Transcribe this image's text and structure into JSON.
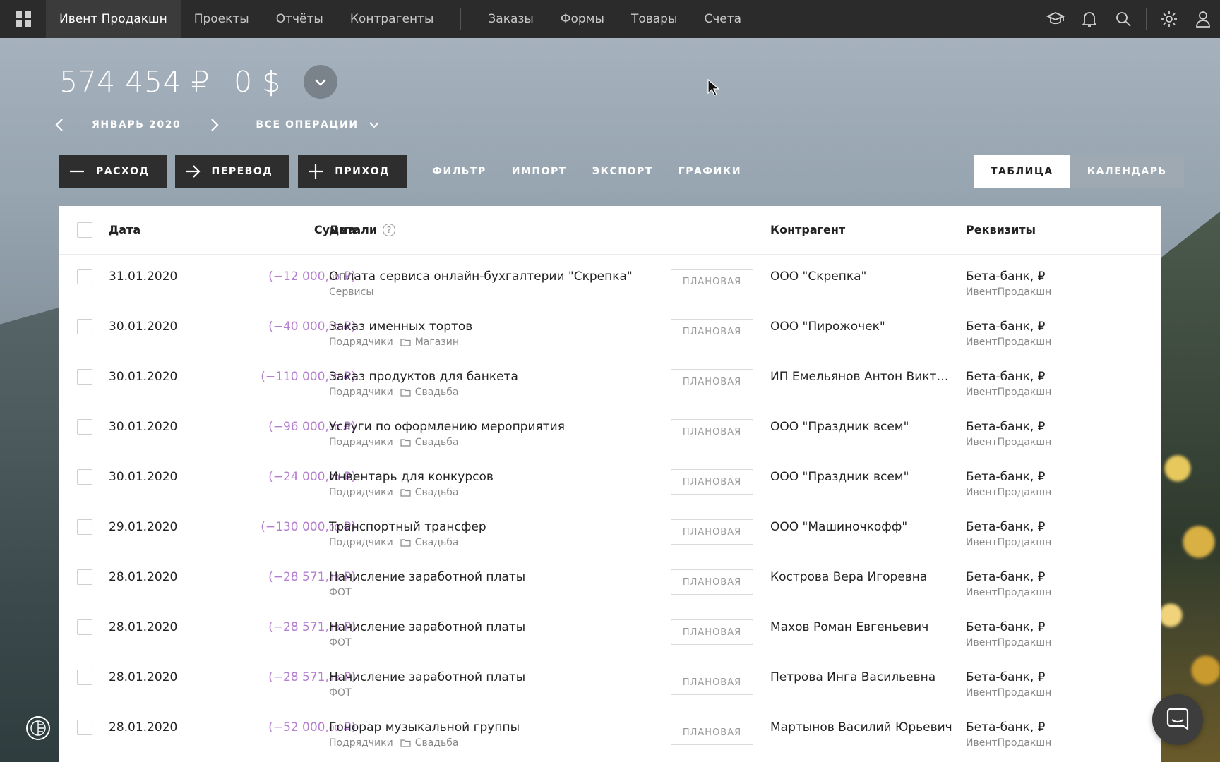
{
  "nav": {
    "company": "Ивент Продакшн",
    "items": [
      "Проекты",
      "Отчёты",
      "Контрагенты"
    ],
    "items2": [
      "Заказы",
      "Формы",
      "Товары",
      "Счета"
    ]
  },
  "balance": {
    "rub": "574 454 ₽",
    "usd": "0 $"
  },
  "period": {
    "month": "ЯНВАРЬ 2020",
    "filter": "ВСЕ ОПЕРАЦИИ"
  },
  "actions": {
    "expense": "РАСХОД",
    "transfer": "ПЕРЕВОД",
    "income": "ПРИХОД",
    "filter": "ФИЛЬТР",
    "import": "ИМПОРТ",
    "export": "ЭКСПОРТ",
    "charts": "ГРАФИКИ"
  },
  "views": {
    "table": "ТАБЛИЦА",
    "calendar": "КАЛЕНДАРЬ"
  },
  "table": {
    "headers": {
      "date": "Дата",
      "sum": "Сумма",
      "details": "Детали",
      "counterparty": "Контрагент",
      "requisites": "Реквизиты"
    },
    "help": "?",
    "rows": [
      {
        "date": "31.01.2020",
        "sum_main": "(−12 000,",
        "sum_kop": "00",
        "sum_end": " ₽)",
        "title": "Оплата сервиса онлайн-бухгалтерии \"Скрепка\"",
        "category": "Сервисы",
        "project": "",
        "status": "ПЛАНОВАЯ",
        "counterparty": "ООО \"Скрепка\"",
        "account": "Бета-банк, ₽",
        "company": "ИвентПродакшн"
      },
      {
        "date": "30.01.2020",
        "sum_main": "(−40 000,",
        "sum_kop": "00",
        "sum_end": " ₽)",
        "title": "Заказ именных тортов",
        "category": "Подрядчики",
        "project": "Магазин",
        "status": "ПЛАНОВАЯ",
        "counterparty": "ООО \"Пирожочек\"",
        "account": "Бета-банк, ₽",
        "company": "ИвентПродакшн"
      },
      {
        "date": "30.01.2020",
        "sum_main": "(−110 000,",
        "sum_kop": "00",
        "sum_end": " ₽)",
        "title": "Заказ продуктов для банкета",
        "category": "Подрядчики",
        "project": "Свадьба",
        "status": "ПЛАНОВАЯ",
        "counterparty": "ИП Емельянов Антон Викторович",
        "account": "Бета-банк, ₽",
        "company": "ИвентПродакшн"
      },
      {
        "date": "30.01.2020",
        "sum_main": "(−96 000,",
        "sum_kop": "00",
        "sum_end": " ₽)",
        "title": "Услуги по оформлению мероприятия",
        "category": "Подрядчики",
        "project": "Свадьба",
        "status": "ПЛАНОВАЯ",
        "counterparty": "ООО \"Праздник всем\"",
        "account": "Бета-банк, ₽",
        "company": "ИвентПродакшн"
      },
      {
        "date": "30.01.2020",
        "sum_main": "(−24 000,",
        "sum_kop": "00",
        "sum_end": " ₽)",
        "title": "Инвентарь для конкурсов",
        "category": "Подрядчики",
        "project": "Свадьба",
        "status": "ПЛАНОВАЯ",
        "counterparty": "ООО \"Праздник всем\"",
        "account": "Бета-банк, ₽",
        "company": "ИвентПродакшн"
      },
      {
        "date": "29.01.2020",
        "sum_main": "(−130 000,",
        "sum_kop": "00",
        "sum_end": " ₽)",
        "title": "Транспортный трансфер",
        "category": "Подрядчики",
        "project": "Свадьба",
        "status": "ПЛАНОВАЯ",
        "counterparty": "ООО \"Машиночкофф\"",
        "account": "Бета-банк, ₽",
        "company": "ИвентПродакшн"
      },
      {
        "date": "28.01.2020",
        "sum_main": "(−28 571,",
        "sum_kop": "43",
        "sum_end": " ₽)",
        "title": "Начисление заработной платы",
        "category": "ФОТ",
        "project": "",
        "status": "ПЛАНОВАЯ",
        "counterparty": "Кострова Вера Игоревна",
        "account": "Бета-банк, ₽",
        "company": "ИвентПродакшн"
      },
      {
        "date": "28.01.2020",
        "sum_main": "(−28 571,",
        "sum_kop": "43",
        "sum_end": " ₽)",
        "title": "Начисление заработной платы",
        "category": "ФОТ",
        "project": "",
        "status": "ПЛАНОВАЯ",
        "counterparty": "Махов Роман Евгеньевич",
        "account": "Бета-банк, ₽",
        "company": "ИвентПродакшн"
      },
      {
        "date": "28.01.2020",
        "sum_main": "(−28 571,",
        "sum_kop": "43",
        "sum_end": " ₽)",
        "title": "Начисление заработной платы",
        "category": "ФОТ",
        "project": "",
        "status": "ПЛАНОВАЯ",
        "counterparty": "Петрова Инга Васильевна",
        "account": "Бета-банк, ₽",
        "company": "ИвентПродакшн"
      },
      {
        "date": "28.01.2020",
        "sum_main": "(−52 000,",
        "sum_kop": "00",
        "sum_end": " ₽)",
        "title": "Гонорар музыкальной группы",
        "category": "Подрядчики",
        "project": "Свадьба",
        "status": "ПЛАНОВАЯ",
        "counterparty": "Мартынов Василий Юрьевич",
        "account": "Бета-банк, ₽",
        "company": "ИвентПродакшн"
      }
    ]
  },
  "colors": {
    "topbar": "#2b2b2b",
    "negative_amount": "#b57fd0",
    "button_dark": "#2e2e2e"
  },
  "icons": [
    "apps-grid-icon",
    "academy-icon",
    "bell-icon",
    "search-icon",
    "gear-icon",
    "user-icon",
    "chevron-down-icon",
    "chevron-left-icon",
    "chevron-right-icon",
    "minus-icon",
    "arrow-right-icon",
    "plus-icon",
    "help-icon",
    "folder-icon",
    "chat-icon",
    "theme-icon"
  ]
}
